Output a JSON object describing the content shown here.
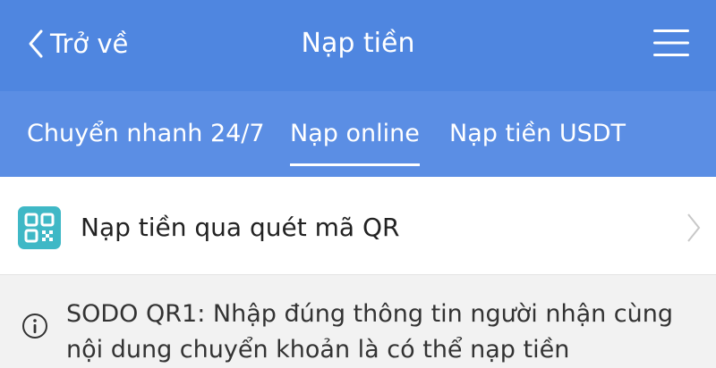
{
  "header": {
    "back_label": "Trở về",
    "title": "Nạp tiền",
    "back_icon": "chevron-left-icon",
    "menu_icon": "hamburger-menu-icon",
    "bg_color": "#4f86e0"
  },
  "tabs": [
    {
      "label": "Chuyển nhanh 24/7",
      "active": false
    },
    {
      "label": "Nạp online",
      "active": true
    },
    {
      "label": "Nạp tiền USDT",
      "active": false
    }
  ],
  "qr_option": {
    "label": "Nạp tiền qua quét mã QR",
    "icon": "qr-code-icon",
    "icon_color": "#3fb8c6"
  },
  "notice": {
    "icon": "info-icon",
    "text": "SODO QR1: Nhập đúng thông tin người nhận cùng nội dung chuyển khoản là có thể nạp tiền"
  }
}
